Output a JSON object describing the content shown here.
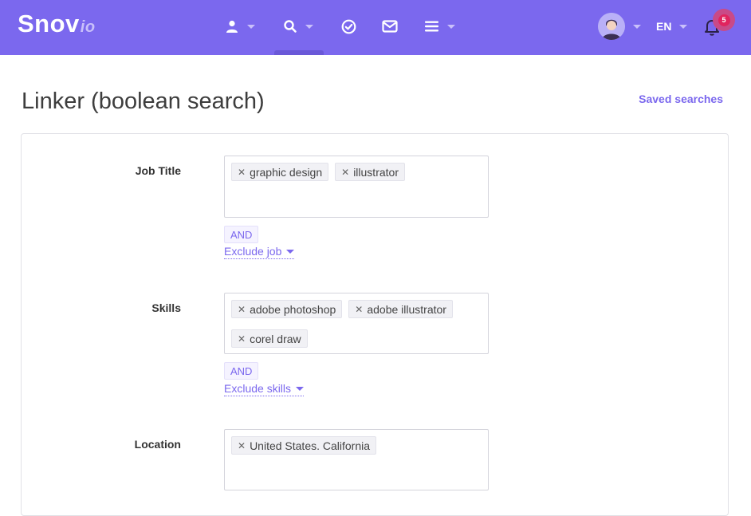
{
  "app": {
    "logo_main": "Snov",
    "logo_suffix": "io"
  },
  "nav": {
    "items": [
      {
        "name": "contacts",
        "icon": "user-icon",
        "has_dropdown": true
      },
      {
        "name": "search",
        "icon": "search-icon",
        "has_dropdown": true,
        "active": true
      },
      {
        "name": "tasks",
        "icon": "check-circle-icon",
        "has_dropdown": false
      },
      {
        "name": "email",
        "icon": "mail-icon",
        "has_dropdown": false
      },
      {
        "name": "menu",
        "icon": "hamburger-icon",
        "has_dropdown": true
      }
    ],
    "language": "EN",
    "notifications_count": "5"
  },
  "colors": {
    "brand": "#7b68ee",
    "badge": "#e0245e"
  },
  "page": {
    "title": "Linker (boolean search)",
    "saved_searches": "Saved searches"
  },
  "form": {
    "job_title": {
      "label": "Job Title",
      "tags": [
        "graphic design",
        "illustrator"
      ],
      "operator": "AND",
      "exclude_label": "Exclude job"
    },
    "skills": {
      "label": "Skills",
      "tags": [
        "adobe photoshop",
        "adobe illustrator",
        "corel draw"
      ],
      "operator": "AND",
      "exclude_label": "Exclude skills"
    },
    "location": {
      "label": "Location",
      "tags": [
        "United States. California"
      ]
    }
  }
}
